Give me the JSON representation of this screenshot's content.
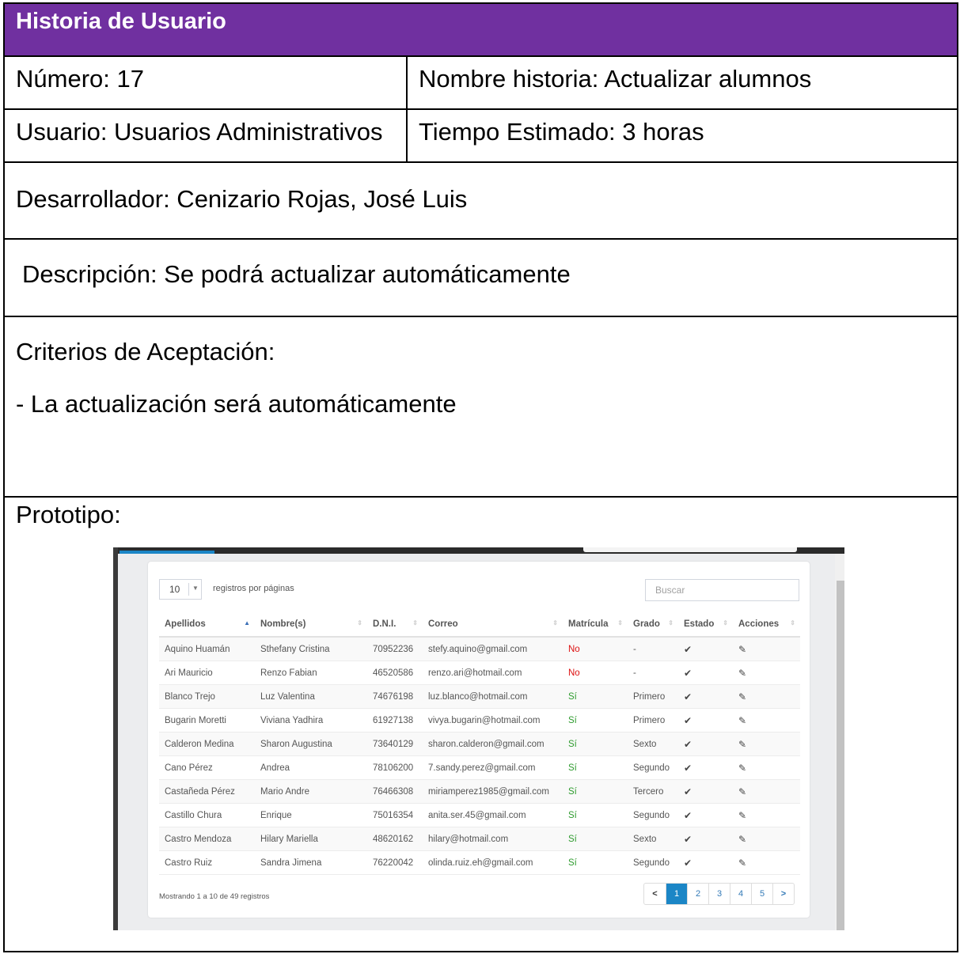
{
  "header": {
    "title": "Historia de Usuario"
  },
  "numero": "Número: 17",
  "nombre_historia": "Nombre historia: Actualizar alumnos",
  "usuario": "Usuario: Usuarios Administrativos",
  "tiempo": "Tiempo Estimado: 3 horas",
  "desarrollador": "Desarrollador:   Cenizario Rojas, José Luis",
  "descripcion": "Descripción: Se podrá actualizar automáticamente",
  "criterios": {
    "label": "Criterios de Aceptación:",
    "item": "-  La actualización será automáticamente"
  },
  "prototipo": {
    "label": "Prototipo:",
    "length_select": "10",
    "per_page_label": "registros por páginas",
    "search_placeholder": "Buscar",
    "columns": [
      "Apellidos",
      "Nombre(s)",
      "D.N.I.",
      "Correo",
      "Matrícula",
      "Grado",
      "Estado",
      "Acciones"
    ],
    "rows": [
      [
        "Aquino Huamán",
        "Sthefany Cristina",
        "70952236",
        "stefy.aquino@gmail.com",
        "No",
        "-"
      ],
      [
        "Ari Mauricio",
        "Renzo Fabian",
        "46520586",
        "renzo.ari@hotmail.com",
        "No",
        "-"
      ],
      [
        "Blanco Trejo",
        "Luz Valentina",
        "74676198",
        "luz.blanco@hotmail.com",
        "Sí",
        "Primero"
      ],
      [
        "Bugarin Moretti",
        "Viviana Yadhira",
        "61927138",
        "vivya.bugarin@hotmail.com",
        "Sí",
        "Primero"
      ],
      [
        "Calderon Medina",
        "Sharon Augustina",
        "73640129",
        "sharon.calderon@gmail.com",
        "Sí",
        "Sexto"
      ],
      [
        "Cano Pérez",
        "Andrea",
        "78106200",
        "7.sandy.perez@gmail.com",
        "Sí",
        "Segundo"
      ],
      [
        "Castañeda Pérez",
        "Mario Andre",
        "76466308",
        "miriamperez1985@gmail.com",
        "Sí",
        "Tercero"
      ],
      [
        "Castillo Chura",
        "Enrique",
        "75016354",
        "anita.ser.45@gmail.com",
        "Sí",
        "Segundo"
      ],
      [
        "Castro Mendoza",
        "Hilary Mariella",
        "48620162",
        "hilary@hotmail.com",
        "Sí",
        "Sexto"
      ],
      [
        "Castro Ruiz",
        "Sandra Jimena",
        "76220042",
        "olinda.ruiz.eh@gmail.com",
        "Sí",
        "Segundo"
      ]
    ],
    "info": "Mostrando 1 a 10 de 49 registros",
    "pages": [
      "1",
      "2",
      "3",
      "4",
      "5"
    ],
    "active_page": "1",
    "colors": {
      "header_bg": "#7030a0",
      "accent": "#1b86c6",
      "no": "#dd1111",
      "si": "#2e9b2e"
    }
  }
}
